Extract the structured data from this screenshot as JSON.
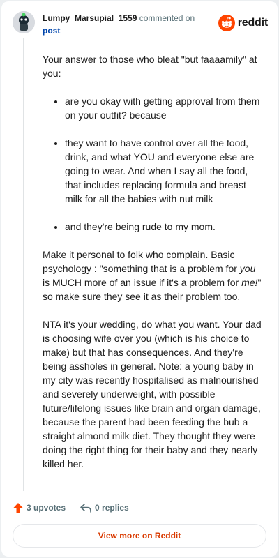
{
  "header": {
    "username": "Lumpy_Marsupial_1559",
    "action_text": "commented on",
    "post_link": "post",
    "brand": "reddit",
    "avatar_icon": "avatar-icon",
    "brand_icon": "reddit-logo-icon"
  },
  "comment": {
    "intro": "Your answer to those who bleat \"but faaaamily\" at you:",
    "bullets": [
      "are you okay with getting approval from them on your outfit? because",
      "they want to have control over all the food, drink, and what YOU and everyone else are going to wear. And when I say all the food, that includes replacing formula and breast milk for all the babies with nut milk",
      "and they're being rude to my mom."
    ],
    "p2_a": "Make it personal to folk who complain. Basic psychology : \"something that is a problem for ",
    "p2_em1": "you",
    "p2_b": " is MUCH more of an issue if it's a problem for ",
    "p2_em2": "me!",
    "p2_c": "\" so make sure they see it as their problem too.",
    "p3": "NTA it's your wedding, do what you want. Your dad is choosing wife over you (which is his choice to make) but that has consequences. And they're being assholes in general. Note: a young baby in my city was recently hospitalised as malnourished and severely underweight, with possible future/lifelong issues like brain and organ damage, because the parent had been feeding the bub a straight almond milk diet. They thought they were doing the right thing for their baby and they nearly killed her."
  },
  "actions": {
    "upvotes": "3 upvotes",
    "replies": "0 replies",
    "upvote_icon": "upvote-arrow-icon",
    "reply_icon": "reply-icon"
  },
  "footer": {
    "view_more": "View more on Reddit"
  },
  "colors": {
    "brand": "#ff4500",
    "link": "#0045ac",
    "cta": "#d93a00",
    "muted": "#576f76"
  }
}
